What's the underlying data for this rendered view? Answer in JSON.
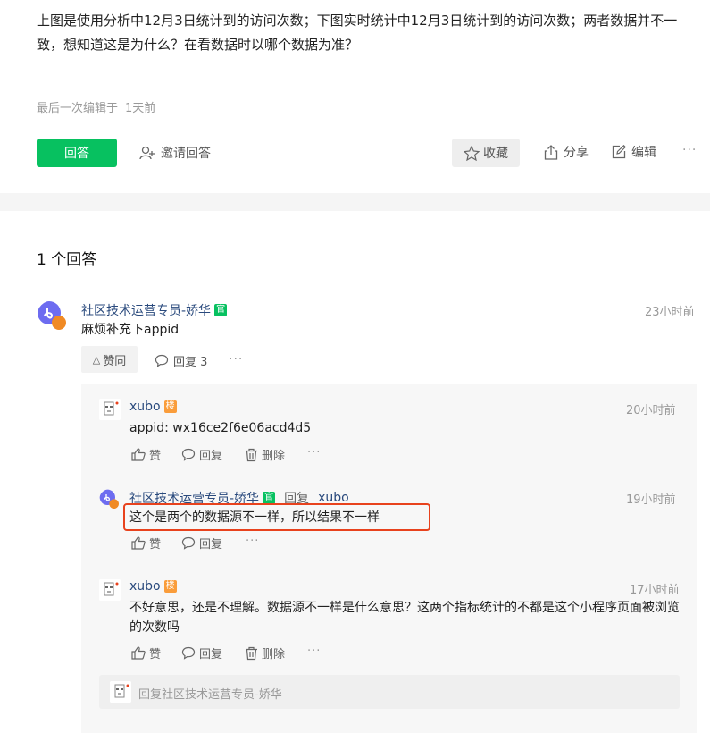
{
  "question": {
    "text": "上图是使用分析中12月3日统计到的访问次数；下图实时统计中12月3日统计到的访问次数；两者数据并不一致，想知道这是为什么？在看数据时以哪个数据为准？",
    "edited_label": "最后一次编辑于",
    "edited_time": "1天前"
  },
  "toolbar": {
    "answer": "回答",
    "invite": "邀请回答",
    "favorite": "收藏",
    "share": "分享",
    "edit": "编辑",
    "more": "···"
  },
  "answers": {
    "count_label": "1 个回答",
    "main": {
      "author": "社区技术运营专员-娇华",
      "badge": "官",
      "time": "23小时前",
      "text": "麻烦补充下appid",
      "agree": "赞同",
      "reply": "回复 3",
      "more": "···"
    },
    "replies": [
      {
        "author": "xubo",
        "badge": "楼",
        "time": "20小时前",
        "text": "appid: wx16ce2f6e06acd4d5",
        "like": "赞",
        "reply": "回复",
        "delete": "删除",
        "more": "···"
      },
      {
        "author": "社区技术运营专员-娇华",
        "badge": "官",
        "reply_to_label": "回复",
        "reply_to": "xubo",
        "time": "19小时前",
        "text": "这个是两个的数据源不一样，所以结果不一样",
        "like": "赞",
        "reply": "回复",
        "more": "···"
      },
      {
        "author": "xubo",
        "badge": "楼",
        "time": "17小时前",
        "text": "不好意思，还是不理解。数据源不一样是什么意思？这两个指标统计的不都是这个小程序页面被浏览的次数吗",
        "like": "赞",
        "reply": "回复",
        "delete": "删除",
        "more": "···"
      }
    ],
    "reply_box_placeholder": "回复社区技术运营专员-娇华"
  },
  "colors": {
    "green": "#07c160",
    "highlight": "#e8421d",
    "link": "#2a4a7d"
  }
}
